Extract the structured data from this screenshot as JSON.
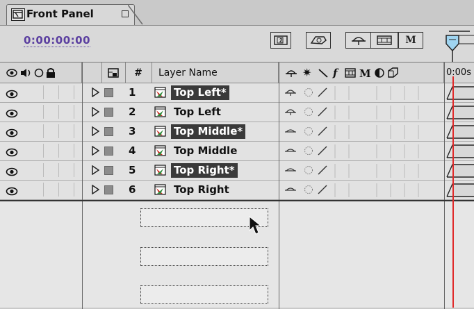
{
  "panel": {
    "tab_title": "Front Panel",
    "timecode": "0:00:00:00",
    "time_ruler_label": "0:00s"
  },
  "header_buttons": [
    {
      "name": "comp-family-button",
      "glyph": "⊠"
    },
    {
      "name": "draft-3d-button",
      "glyph": "◫"
    },
    {
      "name": "shy-button",
      "glyph": "⌓"
    },
    {
      "name": "frame-blending-button",
      "glyph": "▦"
    },
    {
      "name": "motion-blur-button",
      "glyph": "M"
    }
  ],
  "columns": {
    "av_features": "👁◀○🔒",
    "label": "",
    "number": "#",
    "layer_name": "Layer Name",
    "switches": "⌓ ✷ ╲ ƒ ▦ M ◐ ⬡"
  },
  "layers": [
    {
      "number": "1",
      "name": "Top Left*",
      "selected": true,
      "shy_glyph": "⌓"
    },
    {
      "number": "2",
      "name": "Top Left",
      "selected": false,
      "shy_glyph": "⌓"
    },
    {
      "number": "3",
      "name": "Top Middle*",
      "selected": true,
      "shy_glyph": "⌓"
    },
    {
      "number": "4",
      "name": "Top Middle",
      "selected": false,
      "shy_glyph": "⌓"
    },
    {
      "number": "5",
      "name": "Top Right*",
      "selected": true,
      "shy_glyph": "⌓"
    },
    {
      "number": "6",
      "name": "Top Right",
      "selected": false,
      "shy_glyph": "⌓"
    }
  ],
  "colors": {
    "timecode": "#5b3fa0",
    "selected_bg": "#3a3a3a",
    "current_time_indicator": "#e02a2a",
    "label_color": "#8c8c8c"
  }
}
